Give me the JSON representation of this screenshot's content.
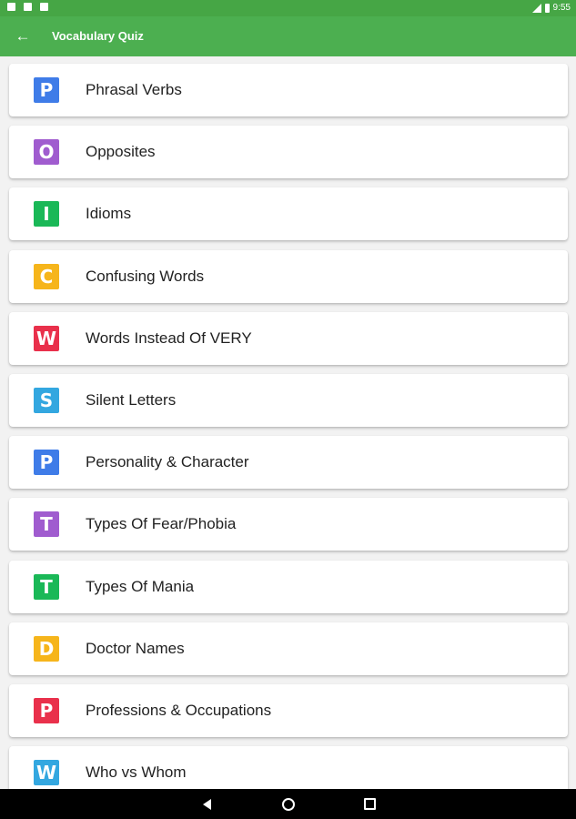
{
  "status": {
    "time": "9:55"
  },
  "app_bar": {
    "back_label": "←",
    "title": "Vocabulary Quiz"
  },
  "categories": [
    {
      "letter": "P",
      "label": "Phrasal Verbs",
      "color": "#3f7ce8"
    },
    {
      "letter": "O",
      "label": "Opposites",
      "color": "#a05ccf"
    },
    {
      "letter": "I",
      "label": "Idioms",
      "color": "#1ab857"
    },
    {
      "letter": "C",
      "label": "Confusing Words",
      "color": "#f6b51b"
    },
    {
      "letter": "W",
      "label": "Words Instead Of VERY",
      "color": "#e9304b"
    },
    {
      "letter": "S",
      "label": "Silent Letters",
      "color": "#33a7e0"
    },
    {
      "letter": "P",
      "label": "Personality & Character",
      "color": "#3f7ce8"
    },
    {
      "letter": "T",
      "label": "Types Of Fear/Phobia",
      "color": "#a05ccf"
    },
    {
      "letter": "T",
      "label": "Types Of Mania",
      "color": "#1ab857"
    },
    {
      "letter": "D",
      "label": "Doctor Names",
      "color": "#f6b51b"
    },
    {
      "letter": "P",
      "label": "Professions & Occupations",
      "color": "#e9304b"
    },
    {
      "letter": "W",
      "label": "Who vs Whom",
      "color": "#33a7e0"
    }
  ],
  "theme": {
    "app_bar": "#4caf50",
    "status_bar": "#46a645"
  },
  "nav": {
    "back_icon": "triangle-back-icon",
    "home_icon": "circle-home-icon",
    "recents_icon": "square-recents-icon"
  }
}
